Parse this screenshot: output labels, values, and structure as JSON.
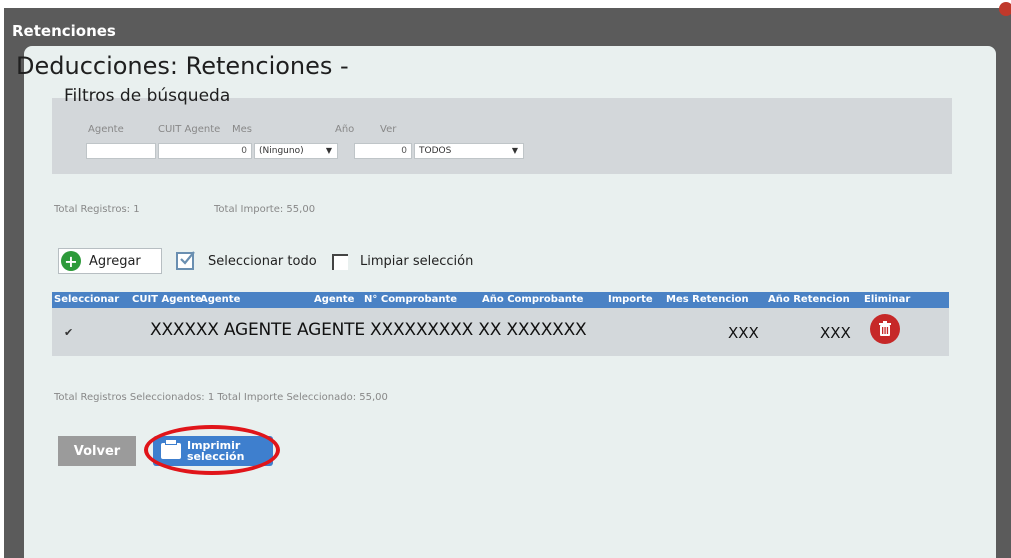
{
  "window": {
    "title": "Retenciones"
  },
  "page": {
    "title": "Deducciones: Retenciones -"
  },
  "filters": {
    "title": "Filtros de búsqueda",
    "agente_label": "Agente",
    "cuit_label": "CUIT Agente",
    "cuit_value": "0",
    "mes_label": "Mes",
    "mes_value": "(Ninguno)",
    "anio_label": "Año",
    "anio_value": "0",
    "ver_label": "Ver",
    "ver_value": "TODOS"
  },
  "totals": {
    "registros": "Total Registros:  1",
    "importe": "Total Importe:  55,00"
  },
  "actions": {
    "agregar": "Agregar",
    "seleccionar_todo": "Seleccionar todo",
    "limpiar": "Limpiar selección"
  },
  "grid": {
    "columns": [
      "Seleccionar",
      "CUIT Agente",
      "Agente",
      "Agente",
      "N° Comprobante",
      "Año Comprobante",
      "Importe",
      "Mes Retencion",
      "Año Retencion",
      "Eliminar"
    ],
    "row": {
      "checked": "✔",
      "text": "XXXXXX AGENTE AGENTE XXXXXXXXX XX XXXXXXX",
      "mes": "XXX",
      "anio": "XXX"
    }
  },
  "selection": {
    "summary": "Total Registros Seleccionados:  1  Total Importe Seleccionado:  55,00"
  },
  "buttons": {
    "volver": "Volver",
    "imprimir_line1": "Imprimir",
    "imprimir_line2": "selección"
  },
  "colors": {
    "header_blue": "#4a82c5",
    "highlight_red": "#e0151a",
    "add_green": "#2d9a3a",
    "delete_red": "#c62828"
  }
}
